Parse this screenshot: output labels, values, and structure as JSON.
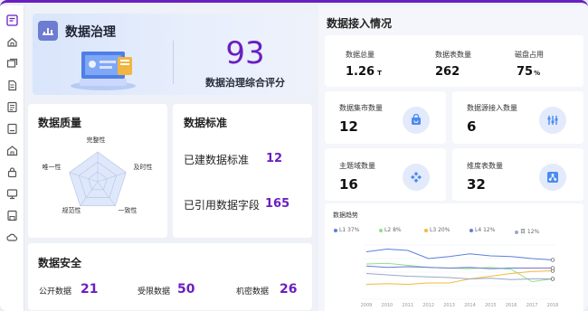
{
  "colors": {
    "accent": "#6a1fc0",
    "icon_blue": "#4a8cf0",
    "icon_bg": "#e3eafb"
  },
  "rail": {
    "icons": [
      "edit-list-icon",
      "home-icon",
      "layers-icon",
      "document-icon",
      "list-icon",
      "monitor-icon",
      "building-icon",
      "lock-icon",
      "screen-icon",
      "save-icon",
      "cloud-icon"
    ]
  },
  "score": {
    "title": "数据治理",
    "value": "93",
    "label": "数据治理综合评分"
  },
  "quality": {
    "title": "数据质量",
    "axes": [
      "完整性",
      "及时性",
      "一致性",
      "规范性",
      "唯一性"
    ]
  },
  "standard": {
    "title": "数据标准",
    "rows": [
      {
        "label": "已建数据标准",
        "value": "12"
      },
      {
        "label": "已引用数据字段",
        "value": "165"
      }
    ]
  },
  "security": {
    "title": "数据安全",
    "items": [
      {
        "label": "公开数据",
        "value": "21"
      },
      {
        "label": "受限数据",
        "value": "50"
      },
      {
        "label": "机密数据",
        "value": "26"
      }
    ]
  },
  "access": {
    "title": "数据接入情况",
    "stats": [
      {
        "label": "数据总量",
        "value": "1.26",
        "unit": "T"
      },
      {
        "label": "数据表数量",
        "value": "262",
        "unit": ""
      },
      {
        "label": "磁盘占用",
        "value": "75",
        "unit": "%"
      }
    ],
    "cards": [
      {
        "label": "数据集市数量",
        "value": "12",
        "icon": "bag-icon"
      },
      {
        "label": "数据源接入数量",
        "value": "6",
        "icon": "bars-icon"
      },
      {
        "label": "主题域数量",
        "value": "16",
        "icon": "diamond-grid-icon"
      },
      {
        "label": "维度表数量",
        "value": "32",
        "icon": "share-icon"
      }
    ]
  },
  "chart_data": {
    "type": "line",
    "title": "数据趋势",
    "x": [
      "2009",
      "2010",
      "2011",
      "2012",
      "2013",
      "2014",
      "2015",
      "2016",
      "2017",
      "2018"
    ],
    "legend": [
      {
        "name": "L1",
        "pct": "37%",
        "color": "#5b7fe0"
      },
      {
        "name": "L2",
        "pct": "8%",
        "color": "#8fe08a"
      },
      {
        "name": "L3",
        "pct": "20%",
        "color": "#f5b83d"
      },
      {
        "name": "L4",
        "pct": "12%",
        "color": "#6a78d8"
      },
      {
        "name": "目",
        "pct": "12%",
        "color": "#9aa6c8"
      }
    ],
    "series": [
      {
        "name": "L1",
        "values": [
          70,
          74,
          72,
          60,
          63,
          67,
          64,
          63,
          60,
          58
        ]
      },
      {
        "name": "L2",
        "values": [
          52,
          53,
          50,
          47,
          46,
          45,
          47,
          44,
          26,
          30
        ]
      },
      {
        "name": "L3",
        "values": [
          22,
          23,
          22,
          24,
          24,
          30,
          34,
          38,
          41,
          42
        ]
      },
      {
        "name": "L4",
        "values": [
          49,
          47,
          48,
          47,
          46,
          47,
          45,
          46,
          46,
          46
        ]
      },
      {
        "name": "L5",
        "values": [
          38,
          36,
          34,
          33,
          32,
          30,
          31,
          29,
          30,
          30
        ]
      }
    ],
    "ylim": [
      0,
      80
    ],
    "grid": true,
    "legend_position": "top"
  }
}
